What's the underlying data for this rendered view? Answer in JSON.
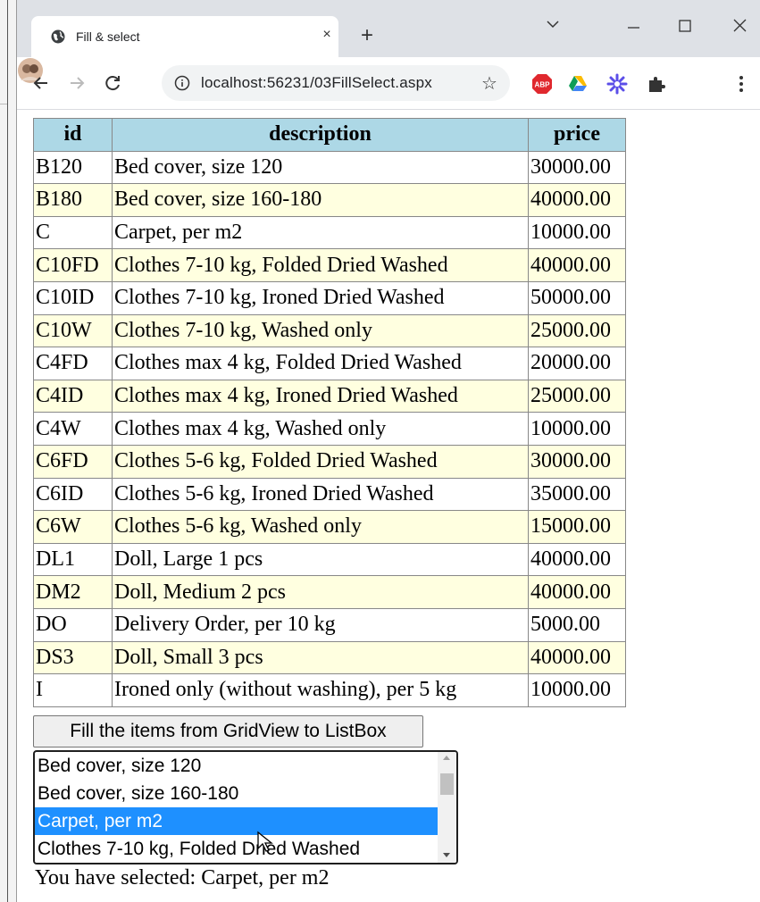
{
  "browser": {
    "tab_title": "Fill & select",
    "url": "localhost:56231/03FillSelect.aspx",
    "new_tab_label": "+",
    "tab_close_label": "×"
  },
  "grid": {
    "headers": [
      "id",
      "description",
      "price"
    ],
    "rows": [
      [
        "B120",
        "Bed cover, size 120",
        "30000.00"
      ],
      [
        "B180",
        "Bed cover, size 160-180",
        "40000.00"
      ],
      [
        "C",
        "Carpet, per m2",
        "10000.00"
      ],
      [
        "C10FD",
        "Clothes 7-10 kg, Folded Dried Washed",
        "40000.00"
      ],
      [
        "C10ID",
        "Clothes 7-10 kg, Ironed Dried Washed",
        "50000.00"
      ],
      [
        "C10W",
        "Clothes 7-10 kg, Washed only",
        "25000.00"
      ],
      [
        "C4FD",
        "Clothes max 4 kg, Folded Dried Washed",
        "20000.00"
      ],
      [
        "C4ID",
        "Clothes max 4 kg, Ironed Dried Washed",
        "25000.00"
      ],
      [
        "C4W",
        "Clothes max 4 kg, Washed only",
        "10000.00"
      ],
      [
        "C6FD",
        "Clothes 5-6 kg, Folded Dried Washed",
        "30000.00"
      ],
      [
        "C6ID",
        "Clothes 5-6 kg, Ironed Dried Washed",
        "35000.00"
      ],
      [
        "C6W",
        "Clothes 5-6 kg, Washed only",
        "15000.00"
      ],
      [
        "DL1",
        "Doll, Large 1 pcs",
        "40000.00"
      ],
      [
        "DM2",
        "Doll, Medium 2 pcs",
        "40000.00"
      ],
      [
        "DO",
        "Delivery Order, per 10 kg",
        "5000.00"
      ],
      [
        "DS3",
        "Doll, Small 3 pcs",
        "40000.00"
      ],
      [
        "I",
        "Ironed only (without washing), per 5 kg",
        "10000.00"
      ]
    ],
    "header_bg": "#add8e6",
    "alt_row_bg": "#ffffe0"
  },
  "fill_button_label": "Fill the items from GridView to ListBox",
  "listbox": {
    "options": [
      "Bed cover, size 120",
      "Bed cover, size 160-180",
      "Carpet, per m2",
      "Clothes 7-10 kg, Folded Dried Washed"
    ],
    "selected_index": 2,
    "selected_bg": "#1e90ff"
  },
  "selection_message": "You have selected: Carpet, per m2",
  "icons": [
    "favicon-globe-icon",
    "info-icon",
    "star-icon",
    "adblock-icon",
    "drive-icon",
    "flower-extension-icon",
    "puzzle-extensions-icon",
    "avatar",
    "menu-dots-icon",
    "back-arrow-icon",
    "forward-arrow-icon",
    "reload-icon",
    "minimize-icon",
    "maximize-icon",
    "close-icon",
    "tab-search-chevron-icon",
    "mouse-pointer-icon"
  ]
}
